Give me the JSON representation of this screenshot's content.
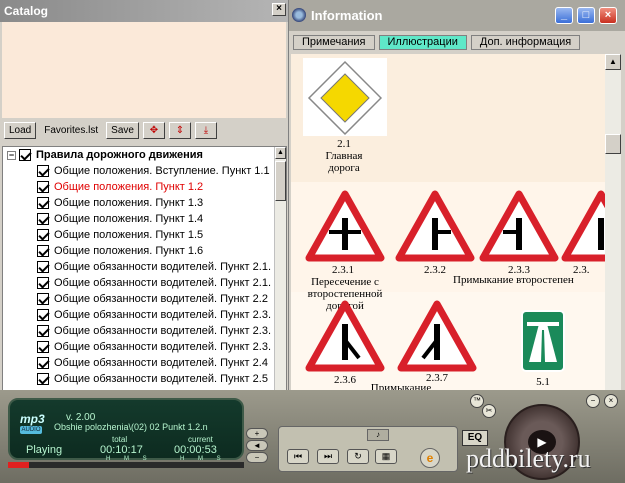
{
  "catalog": {
    "title": "Catalog",
    "close_label": "×",
    "toolbar": {
      "load": "Load",
      "list_name": "Favorites.lst",
      "save": "Save"
    },
    "tree": {
      "root_expander": "−",
      "root_label": "Правила дорожного движения",
      "items": [
        {
          "label": "Общие положения. Вступление. Пункт 1.1"
        },
        {
          "label": "Общие положения. Пункт 1.2",
          "active": true
        },
        {
          "label": "Общие положения. Пункт 1.3"
        },
        {
          "label": "Общие положения. Пункт 1.4"
        },
        {
          "label": "Общие положения. Пункт 1.5"
        },
        {
          "label": "Общие положения. Пункт 1.6"
        },
        {
          "label": "Общие обязанности водителей. Пункт 2.1."
        },
        {
          "label": "Общие обязанности водителей. Пункт 2.1."
        },
        {
          "label": "Общие обязанности водителей. Пункт 2.2"
        },
        {
          "label": "Общие обязанности водителей. Пункт 2.3."
        },
        {
          "label": "Общие обязанности водителей. Пункт 2.3."
        },
        {
          "label": "Общие обязанности водителей. Пункт 2.3."
        },
        {
          "label": "Общие обязанности водителей. Пункт 2.4"
        },
        {
          "label": "Общие обязанности водителей. Пункт 2.5"
        }
      ]
    }
  },
  "info": {
    "title": "Information",
    "minimize": "_",
    "maximize": "□",
    "close": "×",
    "tabs": [
      {
        "label": "Примечания"
      },
      {
        "label": "Иллюстрации",
        "selected": true
      },
      {
        "label": "Доп. информация"
      }
    ],
    "signs": {
      "s21_num": "2.1",
      "s21_name": "Главная дорога",
      "s231_num": "2.3.1",
      "s231_name": "Пересечение с второстепенной дорогой",
      "s232_num": "2.3.2",
      "s233_num": "2.3.3",
      "s234_num": "2.3.",
      "s23x_name": "Примыкание второстепен",
      "s236_num": "2.3.6",
      "s237_num": "2.3.7",
      "s2367_name": "Примыкание",
      "s51_num": "5.1"
    }
  },
  "player": {
    "logo": "mp3",
    "audio_badge": "AUDIO",
    "version": "v. 2.00",
    "track": "Obshie polozhenia\\(02) 02 Punkt 1.2.n",
    "status": "Playing",
    "total_label": "total",
    "current_label": "current",
    "total_time": "00:10:17",
    "current_time": "00:00:53",
    "hms": "H M S",
    "progress": 0.09,
    "eq": "EQ",
    "volume_up": "+",
    "volume_mid": "◄",
    "volume_down": "−"
  },
  "watermark": "pddbilety.ru",
  "colors": {
    "active_item": "#e00000",
    "selected_tab": "#5fe8c8",
    "sign_red": "#d8202a",
    "sign_yellow": "#f5d800",
    "motorway_green": "#1a8a5a"
  }
}
